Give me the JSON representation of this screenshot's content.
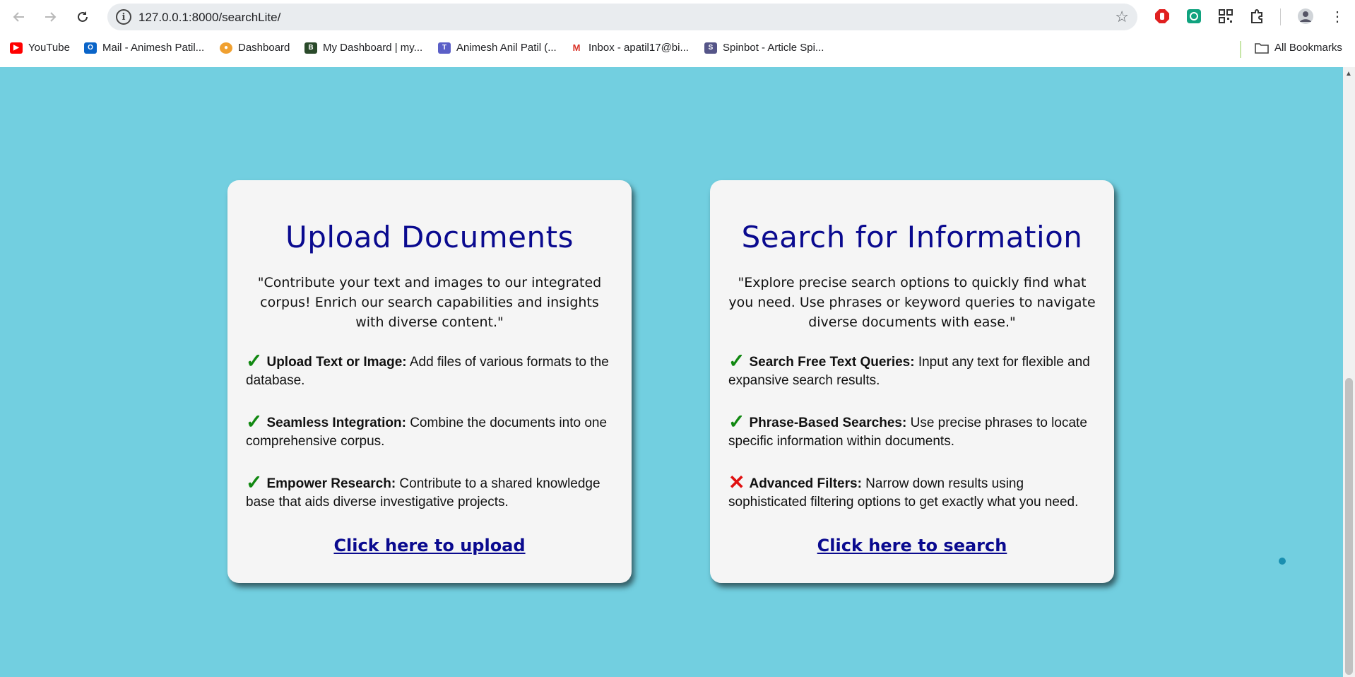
{
  "browser": {
    "url": "127.0.0.1:8000/searchLite/",
    "bookmarks": [
      {
        "label": "YouTube",
        "icon": "youtube-icon",
        "color": "#ff0000"
      },
      {
        "label": "Mail - Animesh Patil...",
        "icon": "outlook-icon",
        "color": "#0a64c8"
      },
      {
        "label": "Dashboard",
        "icon": "dashboard-icon",
        "color": "#f0a030"
      },
      {
        "label": "My Dashboard | my...",
        "icon": "blackboard-icon",
        "color": "#2a4a2a"
      },
      {
        "label": "Animesh Anil Patil (...",
        "icon": "teams-icon",
        "color": "#5b5fc7"
      },
      {
        "label": "Inbox - apatil17@bi...",
        "icon": "gmail-icon",
        "color": "#d93025"
      },
      {
        "label": "Spinbot - Article Spi...",
        "icon": "spinbot-icon",
        "color": "#555588"
      }
    ],
    "all_bookmarks": "All Bookmarks"
  },
  "upload": {
    "title": "Upload Documents",
    "quote": "\"Contribute your text and images to our integrated corpus! Enrich our search capabilities and insights with diverse content.\"",
    "features": [
      {
        "status": "check",
        "title": "Upload Text or Image:",
        "text": " Add files of various formats to the database."
      },
      {
        "status": "check",
        "title": "Seamless Integration:",
        "text": " Combine the documents into one comprehensive corpus."
      },
      {
        "status": "check",
        "title": "Empower Research:",
        "text": " Contribute to a shared knowledge base that aids diverse investigative projects."
      }
    ],
    "link": "Click here to upload"
  },
  "search": {
    "title": "Search for Information",
    "quote": "\"Explore precise search options to quickly find what you need. Use phrases or keyword queries to navigate diverse documents with ease.\"",
    "features": [
      {
        "status": "check",
        "title": "Search Free Text Queries:",
        "text": " Input any text for flexible and expansive search results."
      },
      {
        "status": "check",
        "title": "Phrase-Based Searches:",
        "text": " Use precise phrases to locate specific information within documents."
      },
      {
        "status": "cross",
        "title": "Advanced Filters:",
        "text": " Narrow down results using sophisticated filtering options to get exactly what you need."
      }
    ],
    "link": "Click here to search"
  },
  "colors": {
    "page_background": "#72cfe0",
    "title": "#0a0a8f",
    "check": "#118811",
    "cross": "#e01010"
  }
}
